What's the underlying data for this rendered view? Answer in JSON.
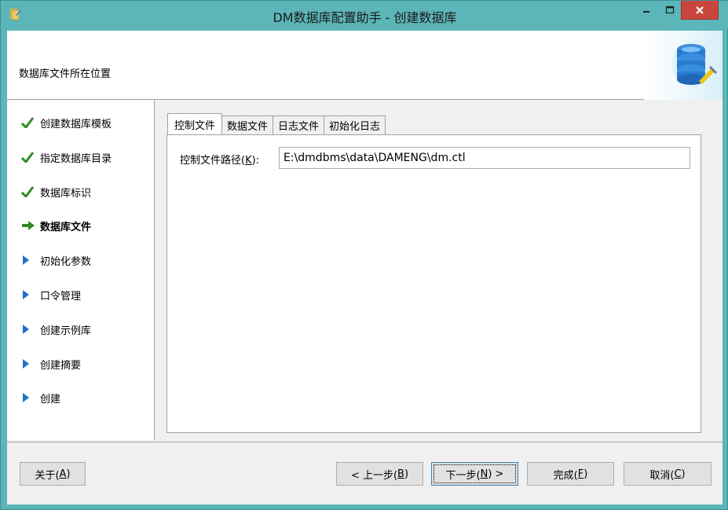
{
  "window": {
    "title": "DM数据库配置助手 - 创建数据库"
  },
  "header": {
    "label": "数据库文件所在位置"
  },
  "nav": {
    "items": [
      {
        "label": "创建数据库模板",
        "state": "done"
      },
      {
        "label": "指定数据库目录",
        "state": "done"
      },
      {
        "label": "数据库标识",
        "state": "done"
      },
      {
        "label": "数据库文件",
        "state": "current"
      },
      {
        "label": "初始化参数",
        "state": "pending"
      },
      {
        "label": "口令管理",
        "state": "pending"
      },
      {
        "label": "创建示例库",
        "state": "pending"
      },
      {
        "label": "创建摘要",
        "state": "pending"
      },
      {
        "label": "创建",
        "state": "pending"
      }
    ]
  },
  "tabs": [
    {
      "label": "控制文件",
      "active": true
    },
    {
      "label": "数据文件",
      "active": false
    },
    {
      "label": "日志文件",
      "active": false
    },
    {
      "label": "初始化日志",
      "active": false
    }
  ],
  "control_file": {
    "label_prefix": "控制文件路径(",
    "label_key": "K",
    "label_suffix": "):",
    "value": "E:\\dmdbms\\data\\DAMENG\\dm.ctl"
  },
  "buttons": {
    "about": {
      "prefix": "关于(",
      "key": "A",
      "suffix": ")"
    },
    "prev": {
      "prefix": "< 上一步(",
      "key": "B",
      "suffix": ")"
    },
    "next": {
      "prefix": "下一步(",
      "key": "N",
      "suffix": ") >"
    },
    "finish": {
      "prefix": "完成(",
      "key": "F",
      "suffix": ")"
    },
    "cancel": {
      "prefix": "取消(",
      "key": "C",
      "suffix": ")"
    }
  },
  "colors": {
    "titlebar": "#5cb5b8",
    "close": "#c9463d",
    "check": "#2e8b22",
    "arrow_current": "#2e8b22",
    "arrow_pending": "#1e73c8"
  }
}
